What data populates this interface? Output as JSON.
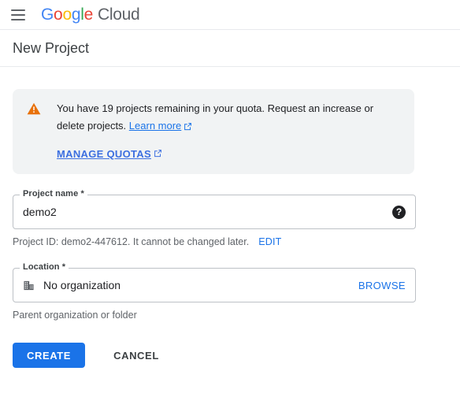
{
  "appbar": {
    "menu_icon": "hamburger-menu-icon",
    "brand": {
      "google": [
        "G",
        "o",
        "o",
        "g",
        "l",
        "e"
      ],
      "suffix": "Cloud"
    }
  },
  "header": {
    "title": "New Project"
  },
  "alert": {
    "icon": "warning-triangle-icon",
    "icon_color": "#e8710a",
    "message_part1": "You have 19 projects remaining in your quota. Request an increase or delete projects.",
    "learn_more_label": "Learn more",
    "learn_more_icon": "external-link-icon",
    "manage_quotas_label": "MANAGE QUOTAS",
    "manage_quotas_icon": "external-link-icon",
    "background": "#f1f3f4"
  },
  "form": {
    "project_name": {
      "label": "Project name *",
      "value": "demo2",
      "placeholder": "Project name",
      "help_icon": "help-question-icon",
      "helper_text": "Project ID: demo2-447612. It cannot be changed later.",
      "edit_label": "EDIT"
    },
    "location": {
      "label": "Location *",
      "icon": "organization-building-icon",
      "value": "No organization",
      "browse_label": "BROWSE",
      "helper_text": "Parent organization or folder"
    }
  },
  "actions": {
    "create_label": "CREATE",
    "cancel_label": "CANCEL",
    "primary_color": "#1a73e8"
  }
}
